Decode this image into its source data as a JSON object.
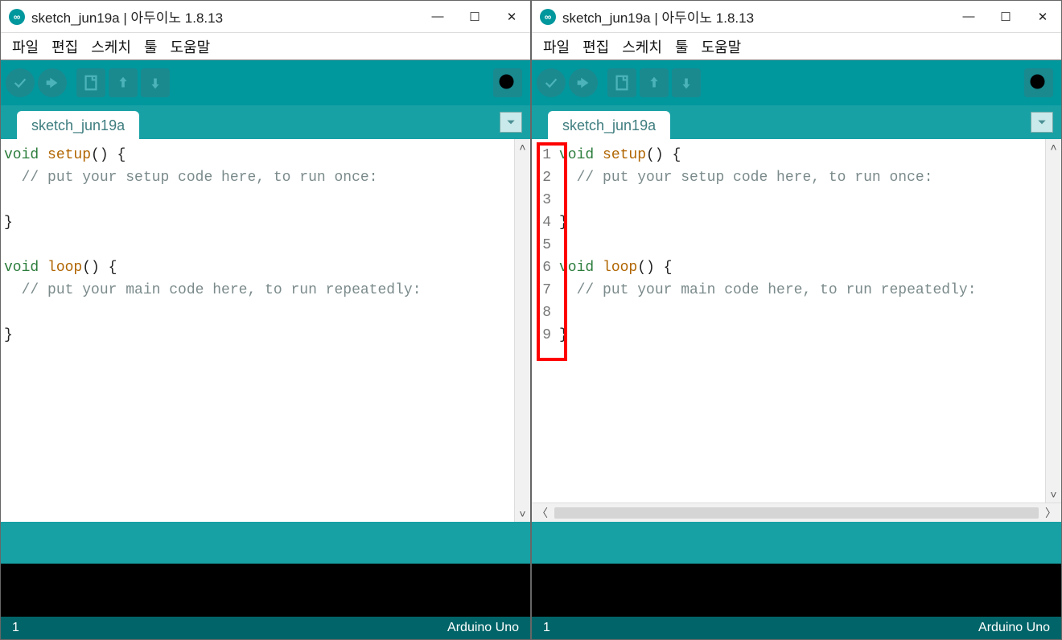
{
  "app_icon_glyph": "∞",
  "left": {
    "title": "sketch_jun19a | 아두이노 1.8.13",
    "menu": [
      "파일",
      "편집",
      "스케치",
      "툴",
      "도움말"
    ],
    "tab": "sketch_jun19a",
    "lines": [
      {
        "t": "code",
        "parts": [
          {
            "c": "kw",
            "s": "void"
          },
          {
            "c": "",
            "s": " "
          },
          {
            "c": "fn",
            "s": "setup"
          },
          {
            "c": "",
            "s": "() {"
          }
        ]
      },
      {
        "t": "code",
        "parts": [
          {
            "c": "",
            "s": "  "
          },
          {
            "c": "cm",
            "s": "// put your setup code here, to run once:"
          }
        ]
      },
      {
        "t": "code",
        "parts": [
          {
            "c": "",
            "s": ""
          }
        ]
      },
      {
        "t": "code",
        "parts": [
          {
            "c": "",
            "s": "}"
          }
        ]
      },
      {
        "t": "code",
        "parts": [
          {
            "c": "",
            "s": ""
          }
        ]
      },
      {
        "t": "code",
        "parts": [
          {
            "c": "kw",
            "s": "void"
          },
          {
            "c": "",
            "s": " "
          },
          {
            "c": "fn",
            "s": "loop"
          },
          {
            "c": "",
            "s": "() {"
          }
        ]
      },
      {
        "t": "code",
        "parts": [
          {
            "c": "",
            "s": "  "
          },
          {
            "c": "cm",
            "s": "// put your main code here, to run repeatedly:"
          }
        ]
      },
      {
        "t": "code",
        "parts": [
          {
            "c": "",
            "s": ""
          }
        ]
      },
      {
        "t": "code",
        "parts": [
          {
            "c": "",
            "s": "}"
          }
        ]
      }
    ],
    "show_line_numbers": false,
    "show_hscroll": false,
    "status_left": "1",
    "status_right": "Arduino Uno"
  },
  "right": {
    "title": "sketch_jun19a | 아두이노 1.8.13",
    "menu": [
      "파일",
      "편집",
      "스케치",
      "툴",
      "도움말"
    ],
    "tab": "sketch_jun19a",
    "lines": [
      {
        "t": "code",
        "parts": [
          {
            "c": "kw",
            "s": "void"
          },
          {
            "c": "",
            "s": " "
          },
          {
            "c": "fn",
            "s": "setup"
          },
          {
            "c": "",
            "s": "() {"
          }
        ]
      },
      {
        "t": "code",
        "parts": [
          {
            "c": "",
            "s": "  "
          },
          {
            "c": "cm",
            "s": "// put your setup code here, to run once:"
          }
        ]
      },
      {
        "t": "code",
        "parts": [
          {
            "c": "",
            "s": ""
          }
        ]
      },
      {
        "t": "code",
        "parts": [
          {
            "c": "",
            "s": "}"
          }
        ]
      },
      {
        "t": "code",
        "parts": [
          {
            "c": "",
            "s": ""
          }
        ]
      },
      {
        "t": "code",
        "parts": [
          {
            "c": "kw",
            "s": "void"
          },
          {
            "c": "",
            "s": " "
          },
          {
            "c": "fn",
            "s": "loop"
          },
          {
            "c": "",
            "s": "() {"
          }
        ]
      },
      {
        "t": "code",
        "parts": [
          {
            "c": "",
            "s": "  "
          },
          {
            "c": "cm",
            "s": "// put your main code here, to run repeatedly:"
          }
        ]
      },
      {
        "t": "code",
        "parts": [
          {
            "c": "",
            "s": ""
          }
        ]
      },
      {
        "t": "code",
        "parts": [
          {
            "c": "",
            "s": "}"
          }
        ]
      }
    ],
    "show_line_numbers": true,
    "line_numbers": [
      1,
      2,
      3,
      4,
      5,
      6,
      7,
      8,
      9
    ],
    "show_hscroll": true,
    "status_left": "1",
    "status_right": "Arduino Uno",
    "highlight_line_numbers": true
  }
}
